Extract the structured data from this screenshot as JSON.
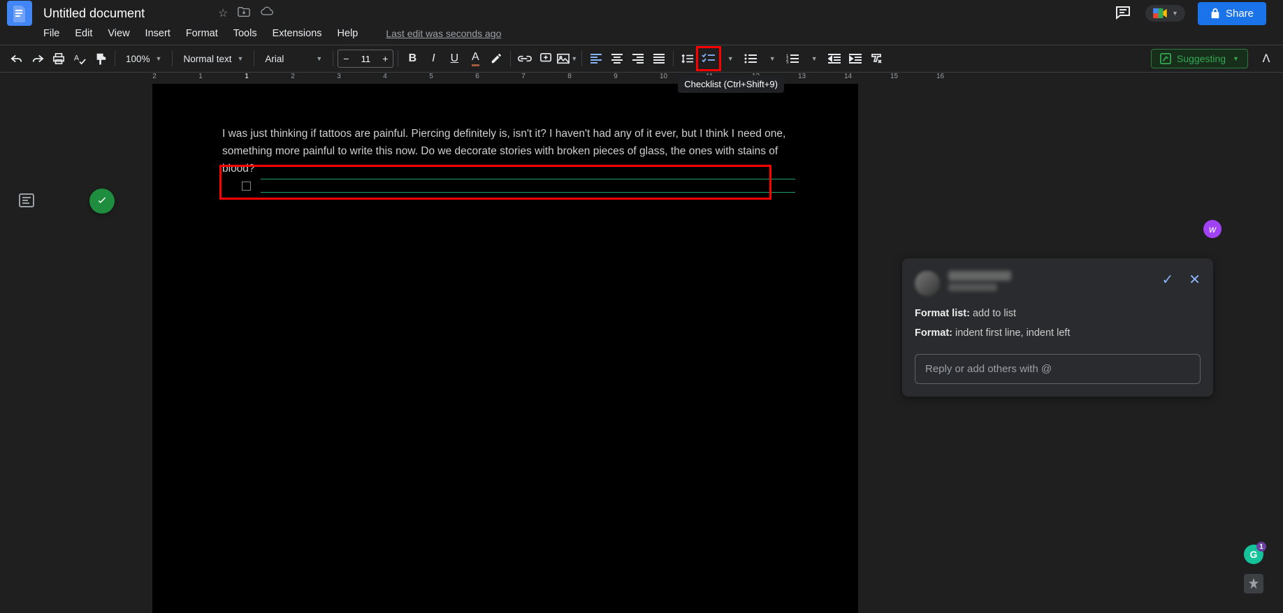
{
  "header": {
    "doc_title": "Untitled document",
    "last_edit": "Last edit was seconds ago",
    "share_label": "Share"
  },
  "menus": [
    "File",
    "Edit",
    "View",
    "Insert",
    "Format",
    "Tools",
    "Extensions",
    "Help"
  ],
  "toolbar": {
    "zoom": "100%",
    "style": "Normal text",
    "font": "Arial",
    "font_size": "11",
    "tooltip": "Checklist (Ctrl+Shift+9)",
    "suggesting": "Suggesting"
  },
  "ruler_marks": [
    "2",
    "1",
    "1",
    "2",
    "3",
    "4",
    "5",
    "6",
    "7",
    "8",
    "9",
    "10",
    "11",
    "12",
    "13",
    "14",
    "15",
    "16"
  ],
  "document": {
    "paragraph": "I was just thinking if tattoos are painful. Piercing definitely is, isn't it? I haven't had any of it ever, but I think I need one, something more painful to write this now. Do we decorate stories with broken pieces of glass, the ones with stains of blood?"
  },
  "suggestion": {
    "line1_label": "Format list:",
    "line1_val": " add to list",
    "line2_label": "Format:",
    "line2_val": " indent first line, indent left",
    "reply_placeholder": "Reply or add others with @"
  },
  "badges": {
    "grammarly_count": "1",
    "purple_letter": "w"
  }
}
